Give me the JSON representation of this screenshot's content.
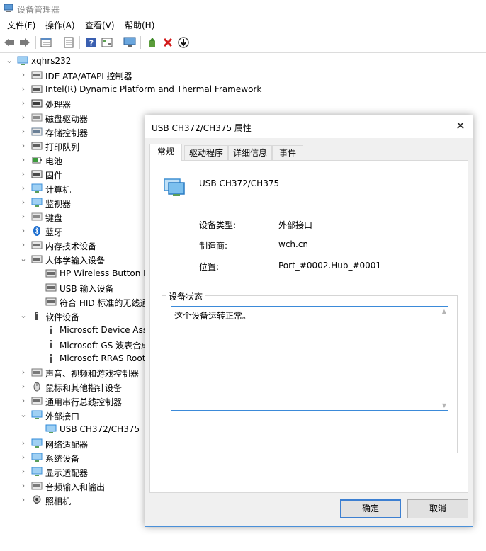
{
  "window": {
    "title": "设备管理器"
  },
  "menu": [
    "文件(F)",
    "操作(A)",
    "查看(V)",
    "帮助(H)"
  ],
  "toolbar": [
    "back-icon",
    "forward-icon",
    "properties-icon",
    "help-doc-icon",
    "help-icon",
    "show-hidden-icon",
    "monitor-icon",
    "update-driver-icon",
    "uninstall-icon",
    "scan-hardware-icon"
  ],
  "tree": [
    {
      "label": "xqhrs232",
      "icon": "computer-icon",
      "expanded": true
    },
    {
      "label": "IDE ATA/ATAPI 控制器",
      "icon": "ide-icon"
    },
    {
      "label": "Intel(R) Dynamic Platform and Thermal Framework",
      "icon": "chip-icon"
    },
    {
      "label": "处理器",
      "icon": "cpu-icon"
    },
    {
      "label": "磁盘驱动器",
      "icon": "disk-icon"
    },
    {
      "label": "存储控制器",
      "icon": "storage-icon"
    },
    {
      "label": "打印队列",
      "icon": "printer-icon"
    },
    {
      "label": "电池",
      "icon": "battery-icon"
    },
    {
      "label": "固件",
      "icon": "firmware-icon"
    },
    {
      "label": "计算机",
      "icon": "monitor-icon"
    },
    {
      "label": "监视器",
      "icon": "monitor-icon"
    },
    {
      "label": "键盘",
      "icon": "keyboard-icon"
    },
    {
      "label": "蓝牙",
      "icon": "bluetooth-icon"
    },
    {
      "label": "内存技术设备",
      "icon": "memory-icon"
    },
    {
      "label": "人体学输入设备",
      "icon": "hid-icon",
      "expanded": true
    },
    {
      "label": "HP Wireless Button D",
      "icon": "hid-icon"
    },
    {
      "label": "USB 输入设备",
      "icon": "hid-icon"
    },
    {
      "label": "符合 HID 标准的无线通",
      "icon": "hid-icon"
    },
    {
      "label": "软件设备",
      "icon": "software-device-icon",
      "expanded": true
    },
    {
      "label": "Microsoft Device Ass",
      "icon": "software-device-icon"
    },
    {
      "label": "Microsoft GS 波表合成",
      "icon": "software-device-icon"
    },
    {
      "label": "Microsoft RRAS Root",
      "icon": "software-device-icon"
    },
    {
      "label": "声音、视频和游戏控制器",
      "icon": "speaker-icon"
    },
    {
      "label": "鼠标和其他指针设备",
      "icon": "mouse-icon"
    },
    {
      "label": "通用串行总线控制器",
      "icon": "usb-icon"
    },
    {
      "label": "外部接口",
      "icon": "network-port-icon",
      "expanded": true
    },
    {
      "label": "USB CH372/CH375",
      "icon": "network-port-icon"
    },
    {
      "label": "网络适配器",
      "icon": "network-icon"
    },
    {
      "label": "系统设备",
      "icon": "system-icon"
    },
    {
      "label": "显示适配器",
      "icon": "display-icon"
    },
    {
      "label": "音频输入和输出",
      "icon": "speaker-icon"
    },
    {
      "label": "照相机",
      "icon": "camera-icon"
    }
  ],
  "dialog": {
    "title": "USB CH372/CH375 属性",
    "tabs": [
      "常规",
      "驱动程序",
      "详细信息",
      "事件"
    ],
    "device_name": "USB CH372/CH375",
    "props": [
      {
        "label": "设备类型:",
        "value": "外部接口"
      },
      {
        "label": "制造商:",
        "value": "wch.cn"
      },
      {
        "label": "位置:",
        "value": "Port_#0002.Hub_#0001"
      }
    ],
    "status_legend": "设备状态",
    "status_text": "这个设备运转正常。",
    "ok": "确定",
    "cancel": "取消"
  }
}
